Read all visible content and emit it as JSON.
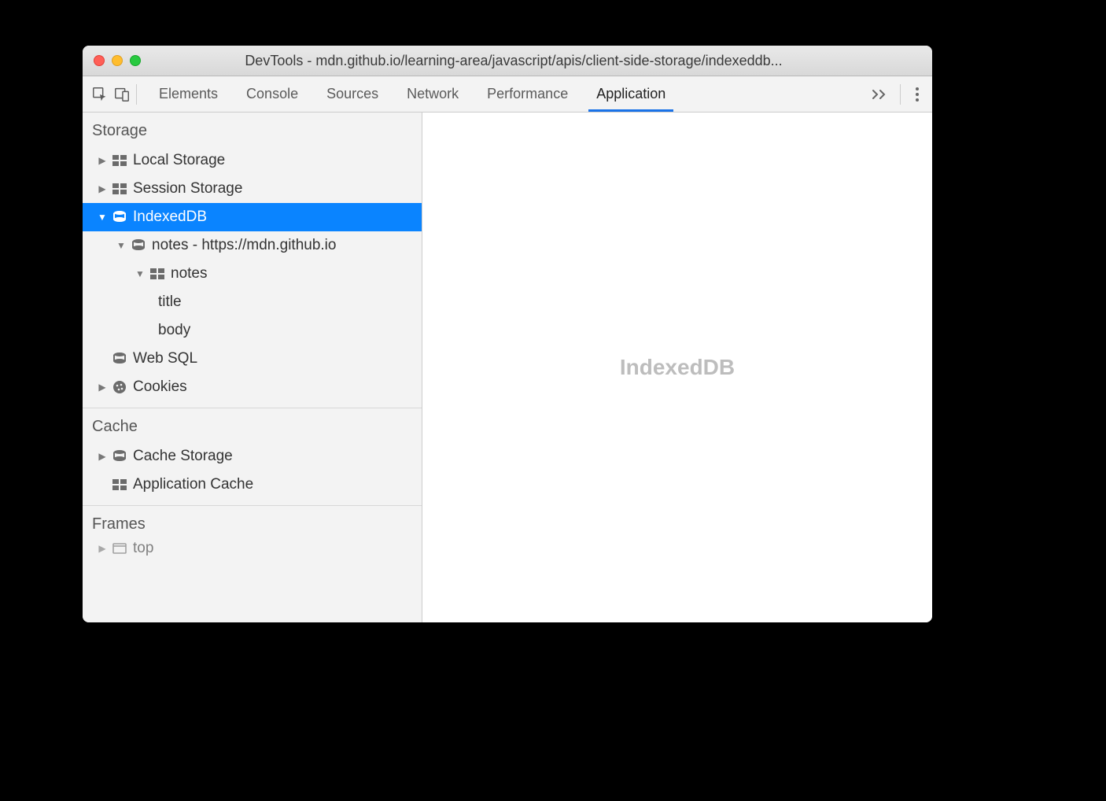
{
  "window": {
    "title": "DevTools - mdn.github.io/learning-area/javascript/apis/client-side-storage/indexeddb..."
  },
  "tabs": {
    "items": [
      "Elements",
      "Console",
      "Sources",
      "Network",
      "Performance",
      "Application"
    ],
    "active": "Application"
  },
  "sidebar": {
    "sections": {
      "storage": {
        "label": "Storage",
        "local_storage": "Local Storage",
        "session_storage": "Session Storage",
        "indexeddb": "IndexedDB",
        "indexeddb_db": "notes - https://mdn.github.io",
        "indexeddb_store": "notes",
        "indexeddb_index_title": "title",
        "indexeddb_index_body": "body",
        "web_sql": "Web SQL",
        "cookies": "Cookies"
      },
      "cache": {
        "label": "Cache",
        "cache_storage": "Cache Storage",
        "application_cache": "Application Cache"
      },
      "frames": {
        "label": "Frames",
        "top": "top"
      }
    }
  },
  "main": {
    "placeholder": "IndexedDB"
  }
}
